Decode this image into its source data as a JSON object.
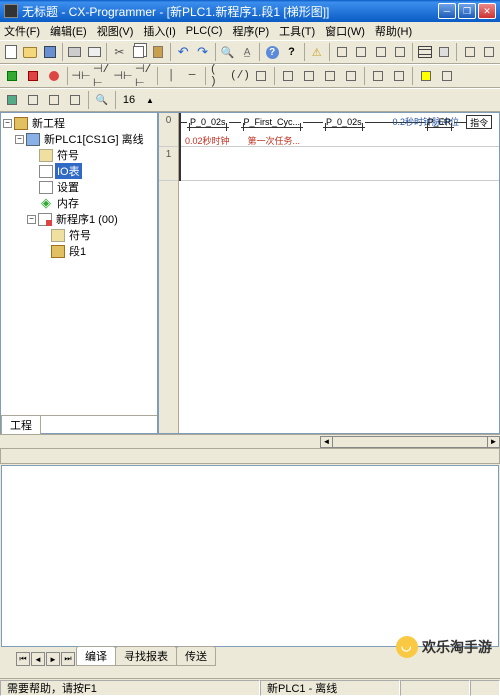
{
  "window": {
    "title": "无标题 - CX-Programmer - [新PLC1.新程序1.段1 [梯形图]]"
  },
  "menu": {
    "file": "文件(F)",
    "edit": "编辑(E)",
    "view": "视图(V)",
    "insert": "插入(I)",
    "plc": "PLC(C)",
    "program": "程序(P)",
    "tool": "工具(T)",
    "window": "窗口(W)",
    "help": "帮助(H)"
  },
  "toolbar3_num": "16",
  "tree": {
    "root": "新工程",
    "plc": "新PLC1[CS1G] 离线",
    "symbols": "符号",
    "io": "IO表",
    "settings": "设置",
    "memory": "内存",
    "program": "新程序1 (00)",
    "prog_symbols": "符号",
    "segment": "段1"
  },
  "sidebar_tab": "工程",
  "ladder": {
    "rung0": "0",
    "rung1": "1",
    "c1": "P_0_02s",
    "c2": "P_First_Cyc...",
    "c3": "P_0_02s",
    "c4": "P_ER",
    "instr": "指令",
    "comment1": "0.02秒时钟",
    "comment2": "第一次任务...",
    "comment_r": "0.2秒时钟脉冲位"
  },
  "output_tabs": {
    "compile": "编译",
    "find": "寻找报表",
    "transfer": "传送"
  },
  "status": {
    "help": "需要帮助，请按F1",
    "plc": "新PLC1 - 离线"
  },
  "watermark": "欢乐淘手游"
}
